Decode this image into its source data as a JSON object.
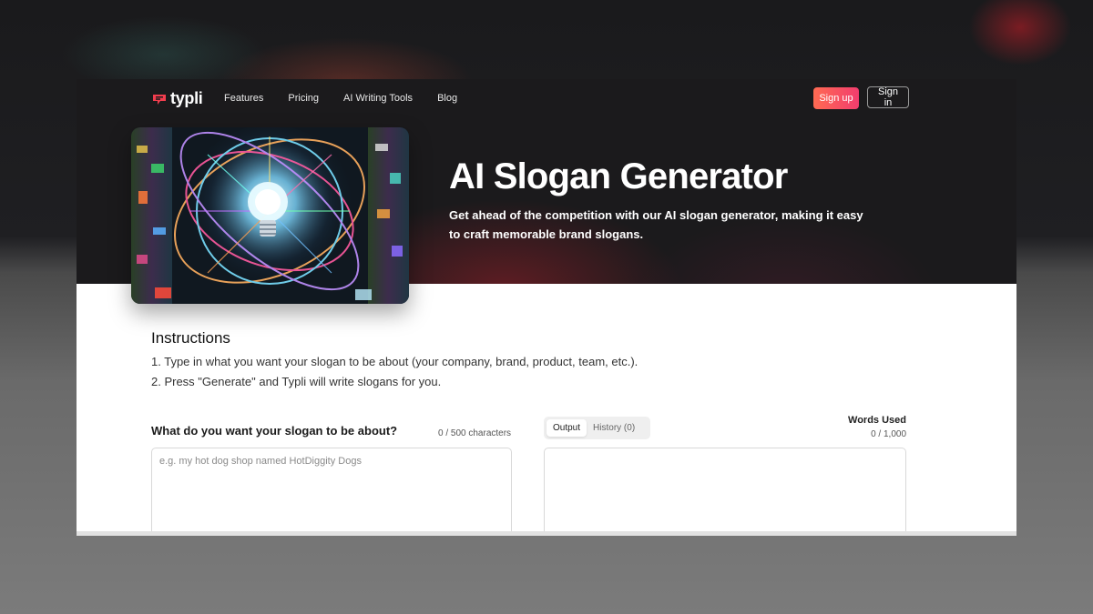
{
  "brand": {
    "logo_text": "typli",
    "accent_start": "#ff6a52",
    "accent_end": "#f23d6e"
  },
  "nav": {
    "items": [
      "Features",
      "Pricing",
      "AI Writing Tools",
      "Blog"
    ],
    "signup_label": "Sign up",
    "signin_label": "Sign in"
  },
  "hero": {
    "title": "AI Slogan Generator",
    "subtitle": "Get ahead of the competition with our AI slogan generator, making it easy to craft memorable brand slogans."
  },
  "instructions": {
    "title": "Instructions",
    "steps": [
      "1. Type in what you want your slogan to be about (your company, brand, product, team, etc.).",
      "2. Press \"Generate\" and Typli will write slogans for you."
    ]
  },
  "input": {
    "label": "What do you want your slogan to be about?",
    "char_count": "0 / 500 characters",
    "placeholder": "e.g. my hot dog shop named HotDiggity Dogs",
    "value": ""
  },
  "output": {
    "tabs": [
      "Output",
      "History (0)"
    ],
    "active_tab": "Output",
    "words_used_label": "Words Used",
    "words_used_count": "0 / 1,000"
  },
  "icons": [
    "typli-logo-icon",
    "lightbulb-illustration"
  ]
}
